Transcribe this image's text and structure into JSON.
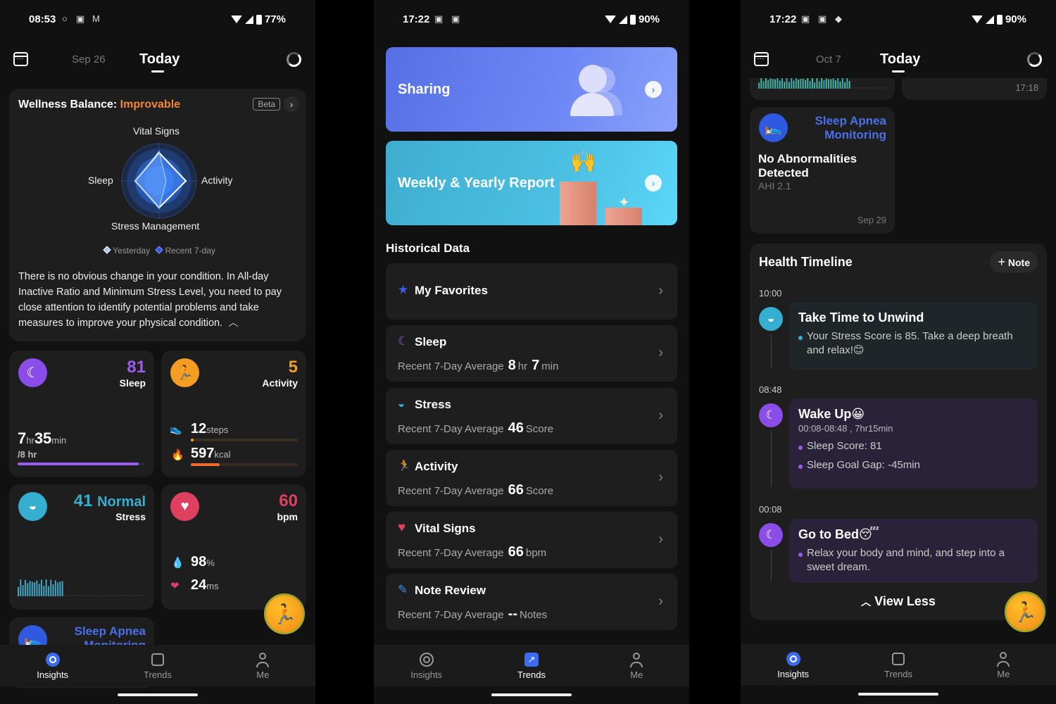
{
  "panel1": {
    "status": {
      "time": "08:53",
      "icons": [
        "circle-notif",
        "outlook",
        "gmail"
      ],
      "battery": "77%"
    },
    "topbar": {
      "prev_date": "Sep 26",
      "current": "Today"
    },
    "wellness": {
      "title": "Wellness Balance:",
      "status": "Improvable",
      "badge": "Beta",
      "axes": {
        "top": "Vital Signs",
        "left": "Sleep",
        "right": "Activity",
        "bottom": "Stress Management"
      },
      "legend": [
        "Yesterday",
        "Recent 7-day"
      ],
      "description": "There is no obvious change in your condition. In All-day Inactive Ratio and Minimum Stress Level, you need to pay close attention to identify potential problems and take measures to improve your physical condition.",
      "collapse_glyph": "︿"
    },
    "sleep_card": {
      "score": "81",
      "label": "Sleep",
      "hr": "7",
      "hr_unit": "hr",
      "min": "35",
      "min_unit": "min",
      "goal": "/8 hr",
      "progress": 0.95
    },
    "activity_card": {
      "score": "5",
      "label": "Activity",
      "steps": "12",
      "steps_unit": "steps",
      "kcal": "597",
      "kcal_unit": "kcal",
      "steps_progress": 0.02,
      "kcal_progress": 0.27
    },
    "stress_card": {
      "score": "41",
      "level": "Normal",
      "label": "Stress"
    },
    "heart_card": {
      "value": "60",
      "unit": "bpm",
      "spo2": "98",
      "spo2_unit": "%",
      "hrv": "24",
      "hrv_unit": "ms"
    },
    "apnea_card": {
      "title": "Sleep Apnea Monitoring"
    },
    "nav": [
      {
        "label": "Insights",
        "active": true
      },
      {
        "label": "Trends",
        "active": false
      },
      {
        "label": "Me",
        "active": false
      }
    ]
  },
  "panel2": {
    "status": {
      "time": "17:22",
      "icons": [
        "outlook",
        "office"
      ],
      "battery": "90%"
    },
    "banners": {
      "sharing": "Sharing",
      "report": "Weekly & Yearly Report"
    },
    "historical_title": "Historical Data",
    "items": [
      {
        "title": "My Favorites",
        "icon": "★"
      },
      {
        "title": "Sleep",
        "icon": "☾",
        "sub": "Recent 7-Day Average",
        "v1": "8",
        "u1": "hr",
        "v2": "7",
        "u2": "min"
      },
      {
        "title": "Stress",
        "icon": "◒",
        "sub": "Recent 7-Day Average",
        "v1": "46",
        "u1": "Score"
      },
      {
        "title": "Activity",
        "icon": "🏃",
        "sub": "Recent 7-Day Average",
        "v1": "66",
        "u1": "Score"
      },
      {
        "title": "Vital Signs",
        "icon": "♥",
        "sub": "Recent 7-Day Average",
        "v1": "66",
        "u1": "bpm"
      },
      {
        "title": "Note Review",
        "icon": "✎",
        "sub": "Recent 7-Day Average",
        "v1": "--",
        "u1": "Notes"
      }
    ],
    "nav": [
      {
        "label": "Insights",
        "active": false
      },
      {
        "label": "Trends",
        "active": true
      },
      {
        "label": "Me",
        "active": false
      }
    ]
  },
  "panel3": {
    "status": {
      "time": "17:22",
      "icons": [
        "outlook",
        "office",
        "bag"
      ],
      "battery": "90%"
    },
    "topbar": {
      "prev_date": "Oct 7",
      "current": "Today"
    },
    "partial_card_time": "17:18",
    "apnea": {
      "title": "Sleep Apnea Monitoring",
      "result": "No Abnormalities Detected",
      "ahi": "AHI 2.1",
      "date": "Sep 29"
    },
    "timeline": {
      "title": "Health Timeline",
      "note_button": "Note",
      "events": [
        {
          "time": "10:00",
          "title": "Take Time to Unwind",
          "bullets": [
            "Your Stress Score is 85. Take a deep breath and relax!😊"
          ]
        },
        {
          "time": "08:48",
          "title": "Wake Up😀",
          "sub": "00:08-08:48 , 7hr15min",
          "bullets": [
            "Sleep Score: 81",
            "Sleep Goal Gap: -45min"
          ]
        },
        {
          "time": "00:08",
          "title": "Go to Bed😴",
          "bullets": [
            "Relax your body and mind, and step into a sweet dream."
          ]
        }
      ],
      "view_less": "View Less"
    },
    "nav": [
      {
        "label": "Insights",
        "active": true
      },
      {
        "label": "Trends",
        "active": false
      },
      {
        "label": "Me",
        "active": false
      }
    ]
  },
  "colors": {
    "sleep": "#8a4de8",
    "activity": "#f59c23",
    "stress": "#35aed0",
    "heart": "#e0405f",
    "apnea": "#2f5ae0",
    "improvable": "#f0873a",
    "nav_active": "#3b6cf0"
  }
}
